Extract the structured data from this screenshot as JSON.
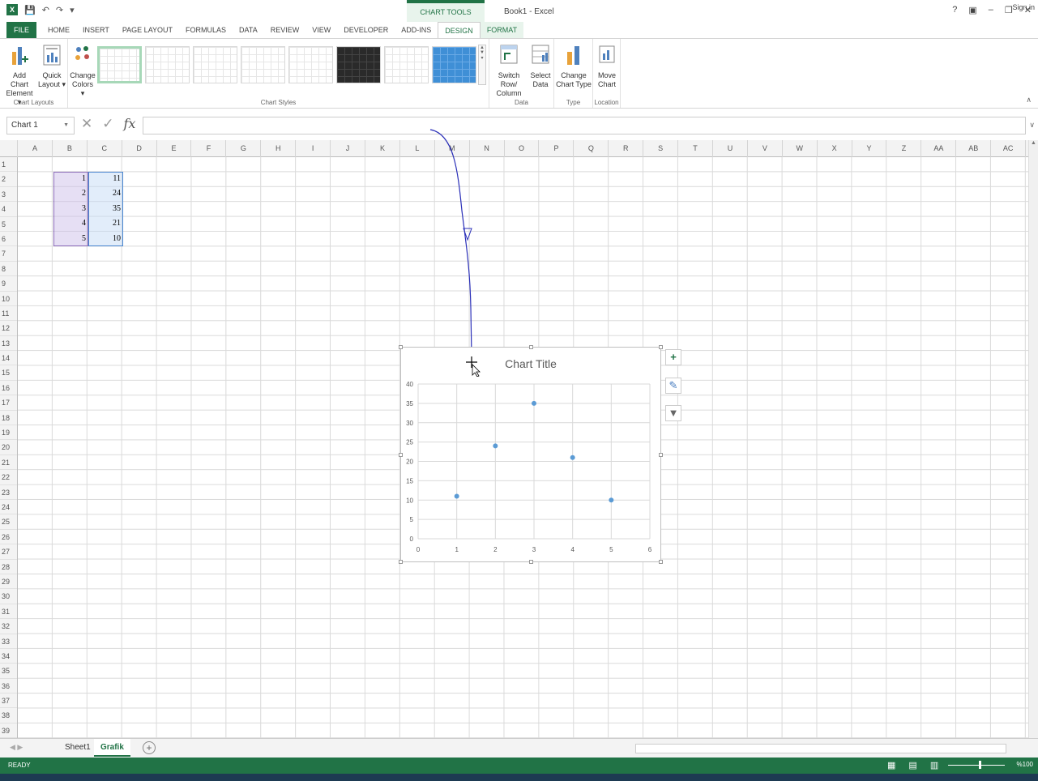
{
  "app": {
    "doc_title": "Book1 - Excel",
    "context_group": "CHART TOOLS",
    "help": "?",
    "sign_in": "Sign in",
    "brand_color": "#217346"
  },
  "tabs": [
    "FILE",
    "HOME",
    "INSERT",
    "PAGE LAYOUT",
    "FORMULAS",
    "DATA",
    "REVIEW",
    "VIEW",
    "DEVELOPER",
    "ADD-INS",
    "DESIGN",
    "FORMAT"
  ],
  "ribbon": {
    "add_chart_element": [
      "Add Chart",
      "Element ▾"
    ],
    "quick_layout": [
      "Quick",
      "Layout ▾"
    ],
    "change_colors": [
      "Change",
      "Colors ▾"
    ],
    "switch_row_col": [
      "Switch Row/",
      "Column"
    ],
    "select_data": [
      "Select",
      "Data"
    ],
    "change_chart_type": [
      "Change",
      "Chart Type"
    ],
    "move_chart": [
      "Move",
      "Chart"
    ],
    "groups": {
      "chart_layouts": "Chart Layouts",
      "chart_styles": "Chart Styles",
      "data": "Data",
      "type": "Type",
      "location": "Location"
    }
  },
  "formula_bar": {
    "name_box": "Chart 1",
    "fx": "fx",
    "value": ""
  },
  "columns": [
    "A",
    "B",
    "C",
    "D",
    "E",
    "F",
    "G",
    "H",
    "I",
    "J",
    "K",
    "L",
    "M",
    "N",
    "O",
    "P",
    "Q",
    "R",
    "S",
    "T",
    "U",
    "V",
    "W",
    "X",
    "Y",
    "Z",
    "AA",
    "AB",
    "AC"
  ],
  "rows": [
    "1",
    "2",
    "3",
    "4",
    "5",
    "6",
    "7",
    "8",
    "9",
    "10",
    "11",
    "12",
    "13",
    "14",
    "15",
    "16",
    "17",
    "18",
    "19",
    "20",
    "21",
    "22",
    "23",
    "24",
    "25",
    "26",
    "27",
    "28",
    "29",
    "30",
    "31",
    "32",
    "33",
    "34",
    "35",
    "36",
    "37",
    "38",
    "39"
  ],
  "cells": {
    "B": [
      "1",
      "2",
      "3",
      "4",
      "5"
    ],
    "C": [
      "11",
      "24",
      "35",
      "21",
      "10"
    ]
  },
  "chart_data": {
    "type": "scatter",
    "title": "Chart Title",
    "x": [
      1,
      2,
      3,
      4,
      5
    ],
    "y": [
      11,
      24,
      35,
      21,
      10
    ],
    "xlim": [
      0,
      6
    ],
    "ylim": [
      0,
      40
    ],
    "x_ticks": [
      "0",
      "1",
      "2",
      "3",
      "4",
      "5",
      "6"
    ],
    "y_ticks": [
      "0",
      "5",
      "10",
      "15",
      "20",
      "25",
      "30",
      "35",
      "40"
    ],
    "grid": true,
    "marker_color": "#5b9bd5"
  },
  "sheets": [
    "Sheet1",
    "Grafik"
  ],
  "active_sheet": "Grafik",
  "status": {
    "mode": "READY",
    "zoom": "%100"
  }
}
